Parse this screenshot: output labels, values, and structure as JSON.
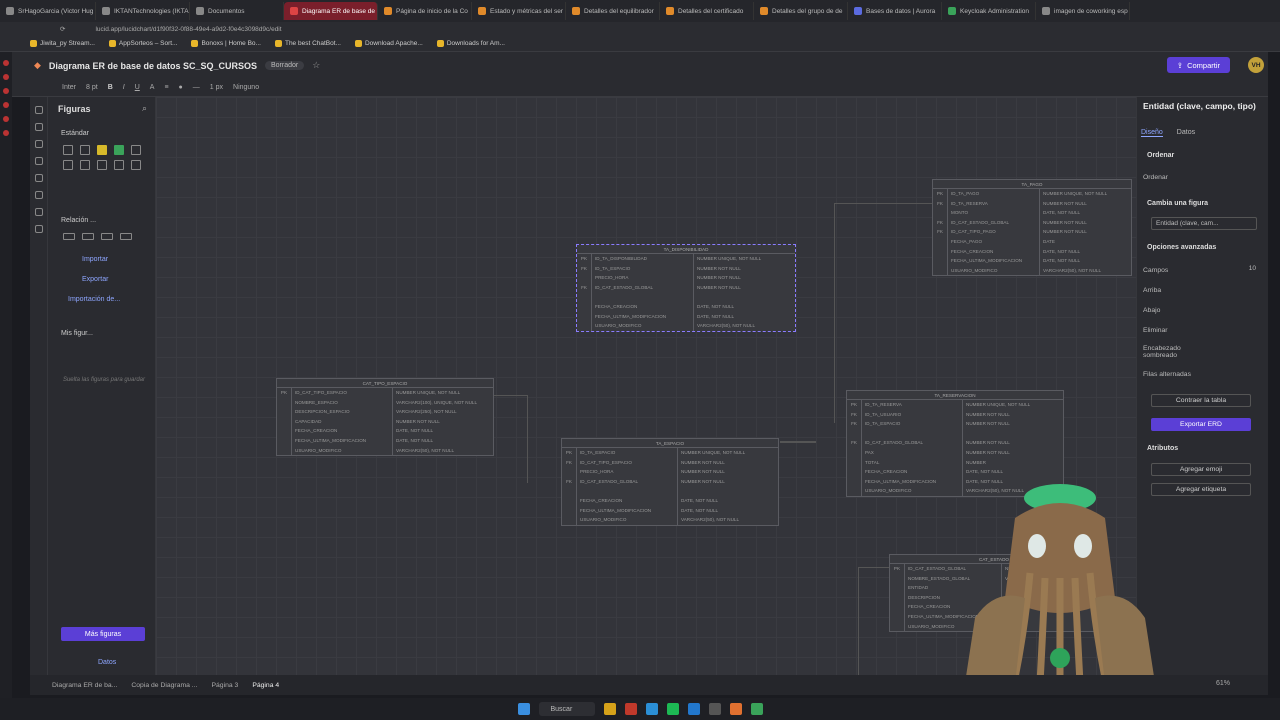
{
  "browser": {
    "tabs": [
      "SrHagoGarcia (Victor Hug",
      "IKTANTechnologies (IKTA",
      "Documentos",
      "Diagrama ER de base de",
      "Página de inicio de la Co",
      "Estado y métricas del ser",
      "Detalles del equilibrador",
      "Detalles del certificado",
      "Detalles del grupo de de",
      "Bases de datos | Aurora",
      "Keycloak Administration",
      "imagen de coworking esp"
    ],
    "active_tab": 3,
    "url": "lucid.app/lucidchart/d1f90f32-0f88-49e4-a9d2-f0e4c3098d9c/edit",
    "bookmarks": [
      "Jiwita_py Stream...",
      "AppSorteos – Sort...",
      "Bonoxs | Home Bo...",
      "The best ChatBot...",
      "Download Apache...",
      "Downloads for Am..."
    ]
  },
  "app": {
    "title": "Diagrama ER de base de datos SC_SQ_CURSOS",
    "status": "Borrador",
    "share": "Compartir",
    "user_initials": "VH"
  },
  "toolbar": {
    "font": "Inter",
    "size": "8 pt",
    "line_width": "1 px",
    "line_style": "Ninguno"
  },
  "left_panel": {
    "title": "Figuras",
    "standard": "Estándar",
    "relation": "Relación ...",
    "import": "Importar",
    "export": "Exportar",
    "import_from": "Importación de...",
    "my_shapes": "Mis figur...",
    "drop_hint": "Suelta las figuras para guardar",
    "more_shapes": "Más figuras",
    "data": "Datos"
  },
  "entities": [
    {
      "title": "TA_DISPONIBILIDAD",
      "rows": [
        [
          "PK",
          "ID_TA_DISPONIBILIDAD",
          "NUMBER UNIQUE, NOT NULL"
        ],
        [
          "FK",
          "ID_TA_ESPACIO",
          "NUMBER NOT NULL"
        ],
        [
          "",
          "PRECIO_HORA",
          "NUMBER NOT NULL"
        ],
        [
          "FK",
          "ID_CAT_ESTADO_GLOBAL",
          "NUMBER NOT NULL"
        ],
        [
          "",
          "",
          ""
        ],
        [
          "",
          "FECHA_CREACION",
          "DATE, NOT NULL"
        ],
        [
          "",
          "FECHA_ULTIMA_MODIFICACION",
          "DATE, NOT NULL"
        ],
        [
          "",
          "USUARIO_MODIFICO",
          "VARCHAR2(50), NOT NULL"
        ]
      ]
    },
    {
      "title": "CAT_TIPO_ESPACIO",
      "rows": [
        [
          "PK",
          "ID_CAT_TIPO_ESPACIO",
          "NUMBER UNIQUE, NOT NULL"
        ],
        [
          "",
          "NOMBRE_ESPACIO",
          "VARCHAR2(100), UNIQUE, NOT NULL"
        ],
        [
          "",
          "DESCRIPCION_ESPACIO",
          "VARCHAR2(250), NOT NULL"
        ],
        [
          "",
          "CAPACIDAD",
          "NUMBER NOT NULL"
        ],
        [
          "",
          "FECHA_CREACION",
          "DATE, NOT NULL"
        ],
        [
          "",
          "FECHA_ULTIMA_MODIFICACION",
          "DATE, NOT NULL"
        ],
        [
          "",
          "USUARIO_MODIFICO",
          "VARCHAR2(50), NOT NULL"
        ]
      ]
    },
    {
      "title": "TA_ESPACIO",
      "rows": [
        [
          "PK",
          "ID_TA_ESPACIO",
          "NUMBER UNIQUE, NOT NULL"
        ],
        [
          "FK",
          "ID_CAT_TIPO_ESPACIO",
          "NUMBER NOT NULL"
        ],
        [
          "",
          "PRECIO_HORA",
          "NUMBER NOT NULL"
        ],
        [
          "FK",
          "ID_CAT_ESTADO_GLOBAL",
          "NUMBER NOT NULL"
        ],
        [
          "",
          "",
          ""
        ],
        [
          "",
          "FECHA_CREACION",
          "DATE, NOT NULL"
        ],
        [
          "",
          "FECHA_ULTIMA_MODIFICACION",
          "DATE, NOT NULL"
        ],
        [
          "",
          "USUARIO_MODIFICO",
          "VARCHAR2(50), NOT NULL"
        ]
      ]
    },
    {
      "title": "TA_PAGO",
      "rows": [
        [
          "PK",
          "ID_TA_PAGO",
          "NUMBER UNIQUE, NOT NULL"
        ],
        [
          "FK",
          "ID_TA_RESERVA",
          "NUMBER NOT NULL"
        ],
        [
          "",
          "MONTO",
          "DATE, NOT NULL"
        ],
        [
          "FK",
          "ID_CAT_ESTADO_GLOBAL",
          "NUMBER NOT NULL"
        ],
        [
          "FK",
          "ID_CAT_TIPO_PAGO",
          "NUMBER NOT NULL"
        ],
        [
          "",
          "FECHA_PAGO",
          "DATE"
        ],
        [
          "",
          "FECHA_CREACION",
          "DATE, NOT NULL"
        ],
        [
          "",
          "FECHA_ULTIMA_MODIFICACION",
          "DATE, NOT NULL"
        ],
        [
          "",
          "USUARIO_MODIFICO",
          "VARCHAR2(50), NOT NULL"
        ]
      ]
    },
    {
      "title": "TA_RESERVACION",
      "rows": [
        [
          "PK",
          "ID_TA_RESERVA",
          "NUMBER UNIQUE, NOT NULL"
        ],
        [
          "FK",
          "ID_TA_USUARIO",
          "NUMBER NOT NULL"
        ],
        [
          "FK",
          "ID_TA_ESPACIO",
          "NUMBER NOT NULL"
        ],
        [
          "",
          "",
          ""
        ],
        [
          "FK",
          "ID_CAT_ESTADO_GLOBAL",
          "NUMBER NOT NULL"
        ],
        [
          "",
          "PAX",
          "NUMBER NOT NULL"
        ],
        [
          "",
          "TOTAL",
          "NUMBER"
        ],
        [
          "",
          "FECHA_CREACION",
          "DATE, NOT NULL"
        ],
        [
          "",
          "FECHA_ULTIMA_MODIFICACION",
          "DATE, NOT NULL"
        ],
        [
          "",
          "USUARIO_MODIFICO",
          "VARCHAR2(50), NOT NULL"
        ]
      ]
    },
    {
      "title": "CAT_ESTADO",
      "rows": [
        [
          "PK",
          "ID_CAT_ESTADO_GLOBAL",
          "NUMBER UNIQUE, NOT NULL"
        ],
        [
          "",
          "NOMBRE_ESTADO_GLOBAL",
          "VARCHAR2(100), NOT NULL"
        ],
        [
          "",
          "ENTIDAD",
          ""
        ],
        [
          "",
          "DESCRIPCION",
          ""
        ],
        [
          "",
          "FECHA_CREACION",
          ""
        ],
        [
          "",
          "FECHA_ULTIMA_MODIFICACION",
          ""
        ],
        [
          "",
          "USUARIO_MODIFICO",
          ""
        ]
      ]
    }
  ],
  "right_panel": {
    "title": "Entidad (clave, campo, tipo)",
    "tab_design": "Diseño",
    "tab_data": "Datos",
    "order_head": "Ordenar",
    "order": "Ordenar",
    "change_shape": "Cambia una figura",
    "shape_value": "Entidad (clave, cam...",
    "advanced": "Opciones avanzadas",
    "fields": "Campos",
    "fields_value": "10",
    "up": "Arriba",
    "down": "Abajo",
    "delete": "Eliminar",
    "shaded_header": "Encabezado sombreado",
    "alt_rows": "Filas alternadas",
    "collapse": "Contraer la tabla",
    "export": "Exportar ERD",
    "attributes": "Atributos",
    "add_emoji": "Agregar emoji",
    "add_tag": "Agregar etiqueta"
  },
  "pages": [
    "Diagrama ER de ba...",
    "Copia de Diagrama ...",
    "Página 3",
    "Página 4"
  ],
  "zoom": "61%",
  "taskbar": {
    "search": "Buscar"
  }
}
